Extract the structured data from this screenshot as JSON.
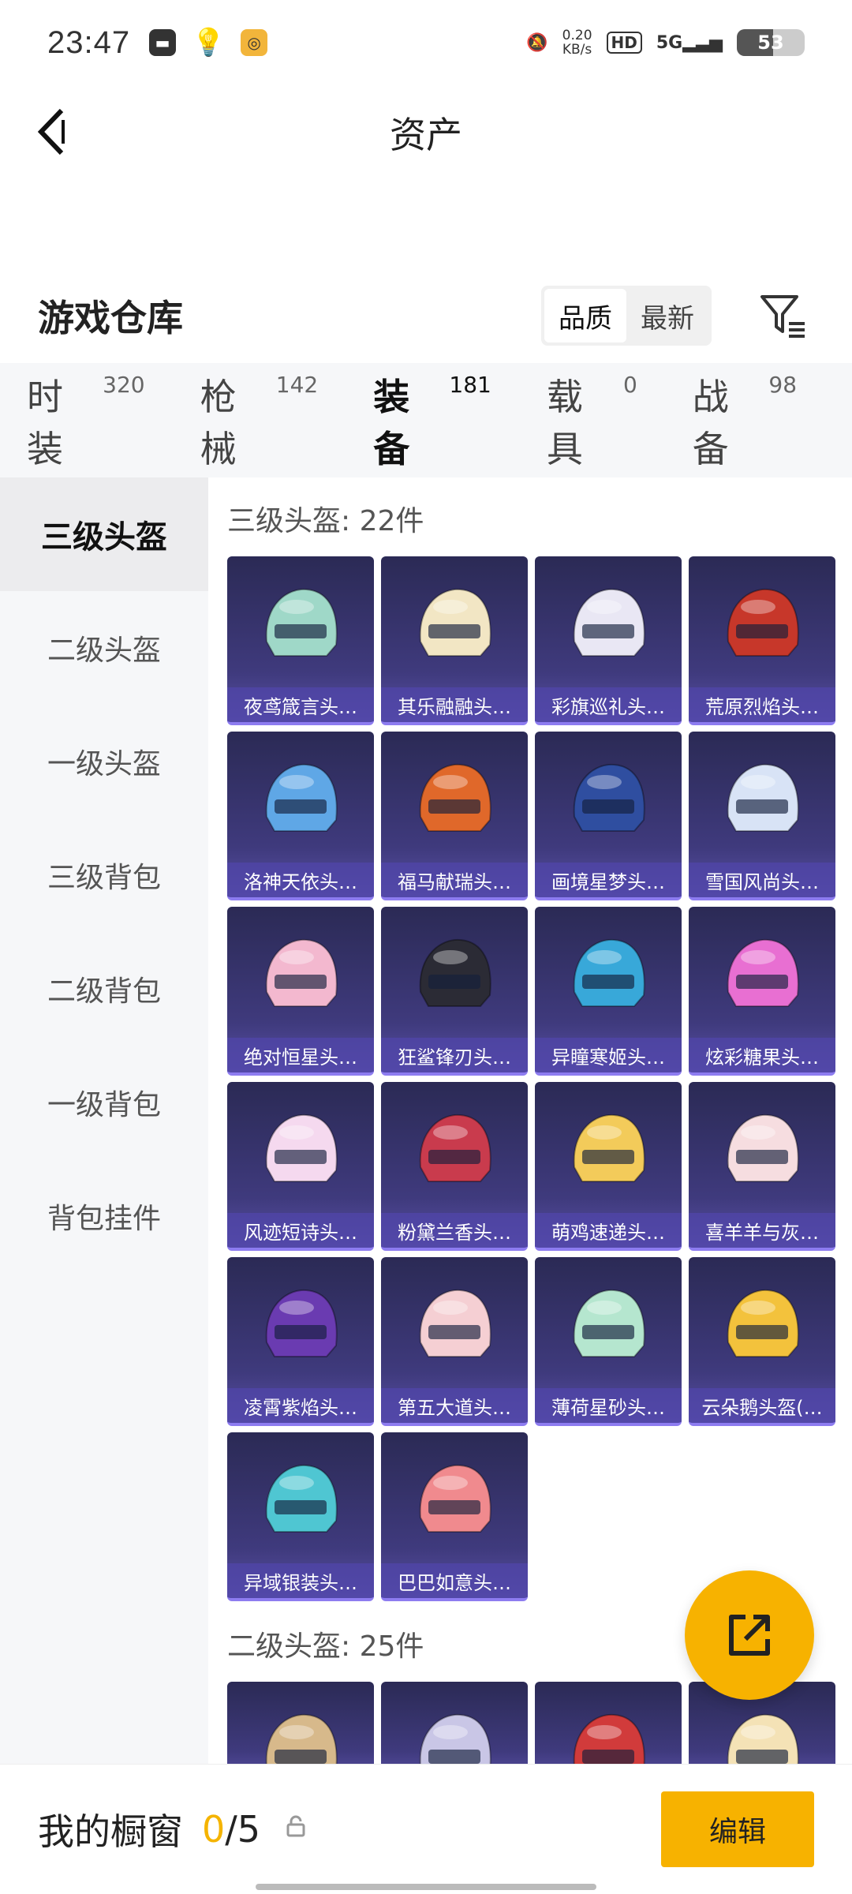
{
  "status_bar": {
    "time": "23:47",
    "net_speed_value": "0.20",
    "net_speed_unit": "KB/s",
    "hd_label": "HD",
    "network": "5G",
    "battery": "53",
    "battery_level": 0.53
  },
  "header": {
    "title": "资产",
    "back_icon": "chevron-left-icon"
  },
  "warehouse": {
    "title": "游戏仓库",
    "sort_options": [
      "品质",
      "最新"
    ],
    "sort_selected": "品质",
    "filter_icon": "filter-icon"
  },
  "tabs": [
    {
      "label": "时装",
      "count": "320"
    },
    {
      "label": "枪械",
      "count": "142"
    },
    {
      "label": "装备",
      "count": "181",
      "active": true
    },
    {
      "label": "载具",
      "count": "0"
    },
    {
      "label": "战备",
      "count": "98"
    }
  ],
  "sidebar": {
    "items": [
      "三级头盔",
      "二级头盔",
      "一级头盔",
      "三级背包",
      "二级背包",
      "一级背包",
      "背包挂件"
    ],
    "active": "三级头盔"
  },
  "sections": [
    {
      "title": "三级头盔: 22件",
      "items": [
        {
          "name": "夜鸢箴言头…",
          "color": "#9fd8c8"
        },
        {
          "name": "其乐融融头…",
          "color": "#f2e6c4"
        },
        {
          "name": "彩旗巡礼头…",
          "color": "#e9e7f4"
        },
        {
          "name": "荒原烈焰头…",
          "color": "#c7372a"
        },
        {
          "name": "洛神天依头…",
          "color": "#5fa7e6"
        },
        {
          "name": "福马献瑞头…",
          "color": "#e0682a"
        },
        {
          "name": "画境星梦头…",
          "color": "#2f4ea0"
        },
        {
          "name": "雪国风尚头…",
          "color": "#d8e3f6"
        },
        {
          "name": "绝对恒星头…",
          "color": "#f3b8cf"
        },
        {
          "name": "狂鲨锋刃头…",
          "color": "#2b2b35"
        },
        {
          "name": "异瞳寒姬头…",
          "color": "#38a8d9"
        },
        {
          "name": "炫彩糖果头…",
          "color": "#e86fd2"
        },
        {
          "name": "风迹短诗头…",
          "color": "#f5d9ef"
        },
        {
          "name": "粉黛兰香头…",
          "color": "#c93b4d"
        },
        {
          "name": "萌鸡速递头…",
          "color": "#f3cb5a"
        },
        {
          "name": "喜羊羊与灰…",
          "color": "#f6dde0"
        },
        {
          "name": "凌霄紫焰头…",
          "color": "#6a3bb1"
        },
        {
          "name": "第五大道头…",
          "color": "#f5cfd3"
        },
        {
          "name": "薄荷星砂头…",
          "color": "#b5e6cf"
        },
        {
          "name": "云朵鹅头盔(…",
          "color": "#f3c23c"
        },
        {
          "name": "异域银装头…",
          "color": "#4fc6d2"
        },
        {
          "name": "巴巴如意头…",
          "color": "#f08a8e"
        }
      ]
    },
    {
      "title": "二级头盔: 25件",
      "items": [
        {
          "name": "",
          "color": "#d7b98b"
        },
        {
          "name": "",
          "color": "#c9c6e6"
        },
        {
          "name": "",
          "color": "#d13b3b"
        },
        {
          "name": "",
          "color": "#f4e2b6"
        }
      ]
    }
  ],
  "fab": {
    "icon": "share-external-icon"
  },
  "bottom_bar": {
    "title": "我的橱窗",
    "count_current": "0",
    "count_total": "/5",
    "lock_icon": "lock-icon",
    "edit_label": "编辑"
  }
}
